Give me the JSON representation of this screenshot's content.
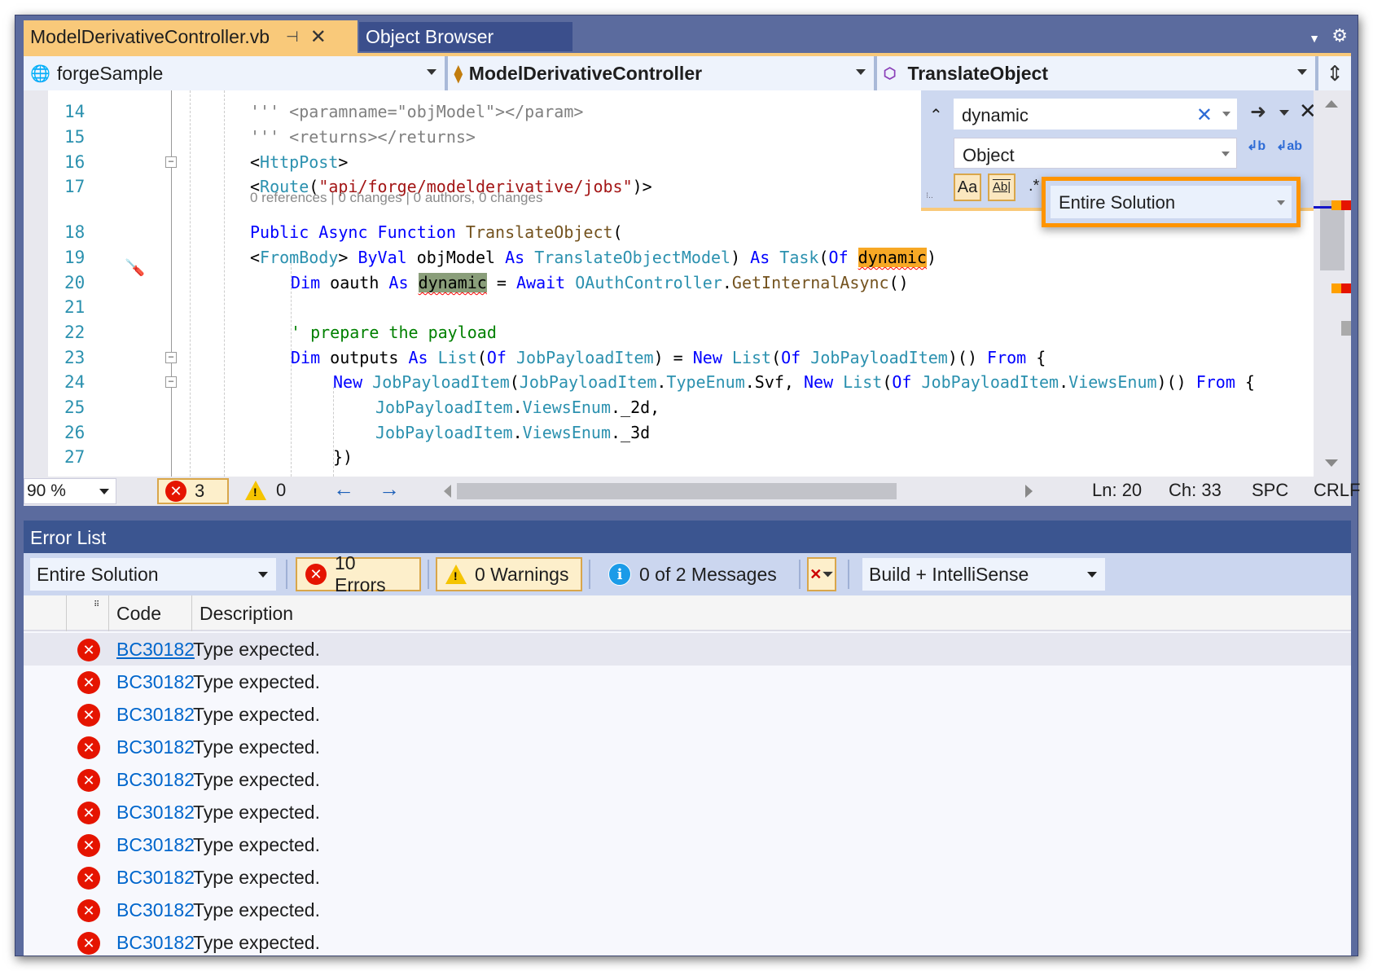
{
  "tabs": {
    "active": {
      "label": "ModelDerivativeController.vb",
      "pin_icon": "pin-icon",
      "close_icon": "close-icon"
    },
    "inactive": {
      "label": "Object Browser"
    },
    "overflow_icon": "chevron-down-icon",
    "settings_icon": "gear-icon"
  },
  "navbar": {
    "project": "forgeSample",
    "class": "ModelDerivativeController",
    "member": "TranslateObject",
    "split_icon": "split-window-icon"
  },
  "editor": {
    "lines": [
      {
        "num": "14"
      },
      {
        "num": "15"
      },
      {
        "num": "16"
      },
      {
        "num": "17"
      },
      {
        "num": "18"
      },
      {
        "num": "19"
      },
      {
        "num": "20"
      },
      {
        "num": "21"
      },
      {
        "num": "22"
      },
      {
        "num": "23"
      },
      {
        "num": "24"
      },
      {
        "num": "25"
      },
      {
        "num": "26"
      },
      {
        "num": "27"
      }
    ],
    "code": {
      "l14a": "''' ",
      "l14b": "<paramname=\"objModel\"></param>",
      "l15a": "''' ",
      "l15b": "<returns></returns>",
      "l16a": "<",
      "l16b": "HttpPost",
      "l16c": ">",
      "l17a": "<",
      "l17b": "Route",
      "l17c": "(",
      "l17d": "\"api/forge/modelderivative/jobs\"",
      "l17e": ")>",
      "codelens": "0 references | 0 changes | 0 authors, 0 changes",
      "l18a": "Public Async Function ",
      "l18b": "TranslateObject",
      "l18c": "(",
      "l19a": "<",
      "l19b": "FromBody",
      "l19c": "> ",
      "l19d": "ByVal",
      "l19e": " objModel ",
      "l19f": "As",
      "l19g": " TranslateObjectModel",
      "l19h": ") ",
      "l19i": "As",
      "l19j": " Task",
      "l19k": "(",
      "l19l": "Of",
      "l19m": " ",
      "l19n": "dynamic",
      "l19o": ")",
      "l20a": "Dim",
      "l20b": " oauth ",
      "l20c": "As",
      "l20d": " ",
      "l20e": "dynamic",
      "l20f": " = ",
      "l20g": "Await",
      "l20h": " OAuthController",
      "l20i": ".",
      "l20j": "GetInternalAsync",
      "l20k": "()",
      "l22": "' prepare the payload",
      "l23a": "Dim",
      "l23b": " outputs ",
      "l23c": "As",
      "l23d": " List",
      "l23e": "(",
      "l23f": "Of",
      "l23g": " JobPayloadItem",
      "l23h": ") = ",
      "l23i": "New",
      "l23j": " List",
      "l23k": "(",
      "l23l": "Of",
      "l23m": " JobPayloadItem",
      "l23n": ")() ",
      "l23o": "From",
      "l23p": " {",
      "l24a": "New",
      "l24b": " JobPayloadItem",
      "l24c": "(",
      "l24d": "JobPayloadItem",
      "l24e": ".",
      "l24f": "TypeEnum",
      "l24g": ".Svf, ",
      "l24h": "New",
      "l24i": " List",
      "l24j": "(",
      "l24k": "Of",
      "l24l": " JobPayloadItem",
      "l24m": ".",
      "l24n": "ViewsEnum",
      "l24o": ")() ",
      "l24p": "From",
      "l24q": " {",
      "l25a": "JobPayloadItem",
      "l25b": ".",
      "l25c": "ViewsEnum",
      "l25d": "._2d,",
      "l26a": "JobPayloadItem",
      "l26b": ".",
      "l26c": "ViewsEnum",
      "l26d": "._3d",
      "l27": "})"
    },
    "quick_action_icon": "screwdriver-icon"
  },
  "find_widget": {
    "search_value": "dynamic",
    "replace_value": "Object",
    "scope_value": "Entire Solution",
    "match_case_label": "Aa",
    "whole_word_label": "Ab|",
    "regex_icon": "regex-icon",
    "replace_next_icon": "replace-next-icon",
    "replace_all_icon": "replace-all-icon"
  },
  "status": {
    "zoom": "90 %",
    "errors": "3",
    "warnings": "0",
    "line": "Ln: 20",
    "col": "Ch: 33",
    "indent": "SPC",
    "eol": "CRLF"
  },
  "error_list": {
    "title": "Error List",
    "scope": "Entire Solution",
    "errors_label": "10 Errors",
    "warnings_label": "0 Warnings",
    "messages_label": "0 of 2 Messages",
    "source": "Build + IntelliSense",
    "columns": {
      "code": "Code",
      "description": "Description"
    },
    "rows": [
      {
        "code": "BC30182",
        "description": "Type expected."
      },
      {
        "code": "BC30182",
        "description": "Type expected."
      },
      {
        "code": "BC30182",
        "description": "Type expected."
      },
      {
        "code": "BC30182",
        "description": "Type expected."
      },
      {
        "code": "BC30182",
        "description": "Type expected."
      },
      {
        "code": "BC30182",
        "description": "Type expected."
      },
      {
        "code": "BC30182",
        "description": "Type expected."
      },
      {
        "code": "BC30182",
        "description": "Type expected."
      },
      {
        "code": "BC30182",
        "description": "Type expected."
      },
      {
        "code": "BC30182",
        "description": "Type expected."
      }
    ]
  },
  "colors": {
    "active_tab": "#f9c97a",
    "highlight_orange": "#ff9400",
    "error_red": "#e51400",
    "keyword_blue": "#0000ff",
    "type_teal": "#2b91af"
  }
}
